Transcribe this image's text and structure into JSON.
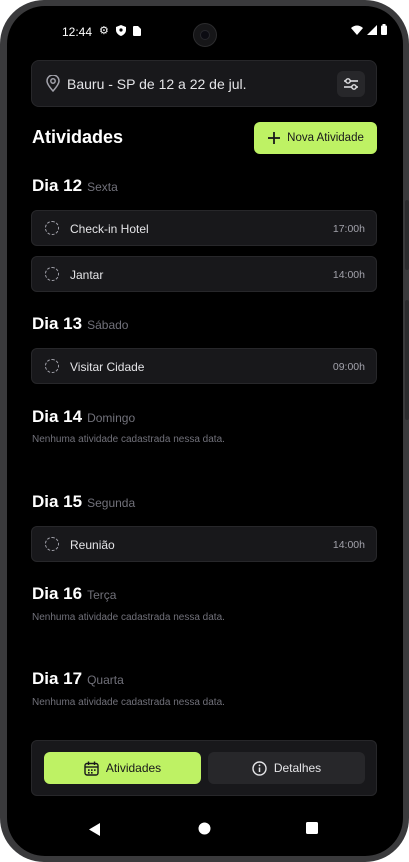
{
  "status_bar": {
    "time": "12:44"
  },
  "location_bar": {
    "text": "Bauru - SP de 12 a 22 de jul."
  },
  "header": {
    "title": "Atividades",
    "new_activity_label": "Nova Atividade"
  },
  "days": [
    {
      "title": "Dia 12",
      "weekday": "Sexta",
      "activities": [
        {
          "name": "Check-in Hotel",
          "time": "17:00h"
        },
        {
          "name": "Jantar",
          "time": "14:00h"
        }
      ]
    },
    {
      "title": "Dia 13",
      "weekday": "Sábado",
      "activities": [
        {
          "name": "Visitar Cidade",
          "time": "09:00h"
        }
      ]
    },
    {
      "title": "Dia 14",
      "weekday": "Domingo",
      "empty_text": "Nenhuma atividade cadastrada nessa data."
    },
    {
      "title": "Dia 15",
      "weekday": "Segunda",
      "activities": [
        {
          "name": "Reunião",
          "time": "14:00h"
        }
      ]
    },
    {
      "title": "Dia 16",
      "weekday": "Terça",
      "empty_text": "Nenhuma atividade cadastrada nessa data."
    },
    {
      "title": "Dia 17",
      "weekday": "Quarta",
      "empty_text": "Nenhuma atividade cadastrada nessa data."
    }
  ],
  "tabs": [
    {
      "label": "Atividades",
      "icon": "calendar-icon",
      "active": true
    },
    {
      "label": "Detalhes",
      "icon": "info-icon",
      "active": false
    }
  ],
  "colors": {
    "accent": "#bef264",
    "background": "#000000",
    "card": "#18181b",
    "border": "#27272a"
  }
}
